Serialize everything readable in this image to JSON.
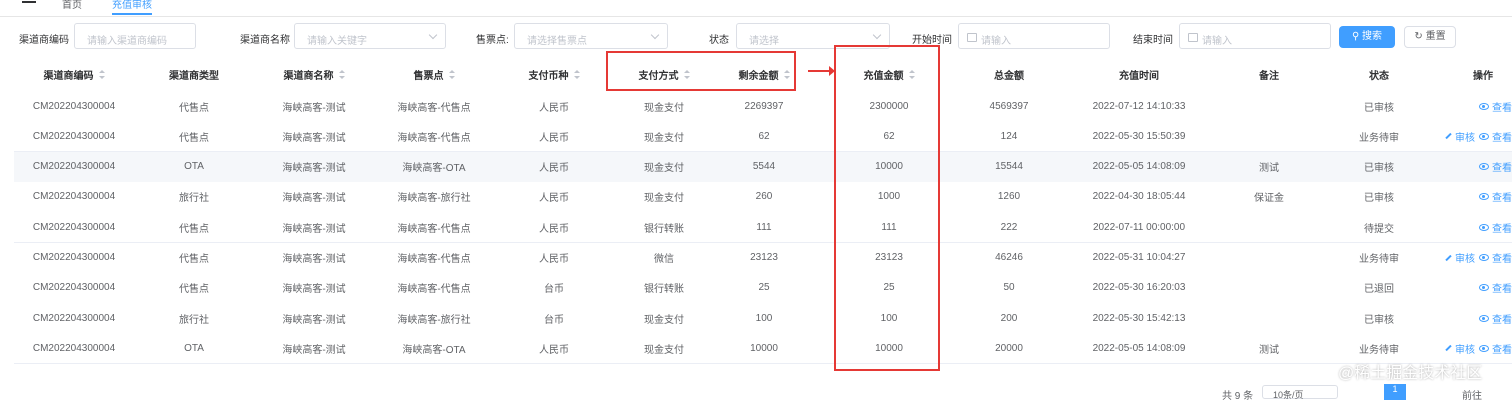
{
  "nav": {
    "breadcrumb_home": "首页",
    "breadcrumb_current": "充值审核"
  },
  "filters": {
    "code_label": "渠道商编码",
    "code_placeholder": "请输入渠道商编码",
    "name_label": "渠道商名称",
    "name_placeholder": "请输入关键字",
    "point_label": "售票点:",
    "point_placeholder": "请选择售票点",
    "status_label": "状态",
    "status_placeholder": "请选择",
    "start_label": "开始时间",
    "start_placeholder": "请输入",
    "end_label": "结束时间",
    "end_placeholder": "请输入",
    "search_label": "搜索",
    "reset_label": "重置"
  },
  "table": {
    "headers": [
      "渠道商编码",
      "渠道商类型",
      "渠道商名称",
      "售票点",
      "支付币种",
      "支付方式",
      "剩余金额",
      "充值金额",
      "总金额",
      "充值时间",
      "备注",
      "状态",
      "操作"
    ],
    "rows": [
      [
        "CM202204300004",
        "代售点",
        "海峡高客-测试",
        "海峡高客-代售点",
        "人民币",
        "现金支付",
        "2269397",
        "2300000",
        "4569397",
        "2022-07-12 14:10:33",
        "",
        "已审核"
      ],
      [
        "CM202204300004",
        "代售点",
        "海峡高客-测试",
        "海峡高客-代售点",
        "人民币",
        "现金支付",
        "62",
        "62",
        "124",
        "2022-05-30 15:50:39",
        "",
        "业务待审"
      ],
      [
        "CM202204300004",
        "OTA",
        "海峡高客-测试",
        "海峡高客-OTA",
        "人民币",
        "现金支付",
        "5544",
        "10000",
        "15544",
        "2022-05-05 14:08:09",
        "测试",
        "已审核"
      ],
      [
        "CM202204300004",
        "旅行社",
        "海峡高客-测试",
        "海峡高客-旅行社",
        "人民币",
        "现金支付",
        "260",
        "1000",
        "1260",
        "2022-04-30 18:05:44",
        "保证金",
        "已审核"
      ],
      [
        "CM202204300004",
        "代售点",
        "海峡高客-测试",
        "海峡高客-代售点",
        "人民币",
        "银行转账",
        "111",
        "111",
        "222",
        "2022-07-11 00:00:00",
        "",
        "待提交"
      ],
      [
        "CM202204300004",
        "代售点",
        "海峡高客-测试",
        "海峡高客-代售点",
        "人民币",
        "微信",
        "23123",
        "23123",
        "46246",
        "2022-05-31 10:04:27",
        "",
        "业务待审"
      ],
      [
        "CM202204300004",
        "代售点",
        "海峡高客-测试",
        "海峡高客-代售点",
        "台币",
        "银行转账",
        "25",
        "25",
        "50",
        "2022-05-30 16:20:03",
        "",
        "已退回"
      ],
      [
        "CM202204300004",
        "旅行社",
        "海峡高客-测试",
        "海峡高客-旅行社",
        "台币",
        "现金支付",
        "100",
        "100",
        "200",
        "2022-05-30 15:42:13",
        "",
        "已审核"
      ],
      [
        "CM202204300004",
        "OTA",
        "海峡高客-测试",
        "海峡高客-OTA",
        "人民币",
        "现金支付",
        "10000",
        "10000",
        "20000",
        "2022-05-05 14:08:09",
        "测试",
        "业务待审"
      ]
    ],
    "audit_rows": [
      1,
      5,
      8
    ],
    "audit_label": "审核",
    "view_label": "查看"
  },
  "pager": {
    "total": "共 9 条",
    "page_size": "10条/页",
    "current": "1",
    "goto": "前往"
  },
  "watermark": "@稀土掘金技术社区",
  "colors": {
    "primary": "#409eff",
    "annotation": "#e53935"
  }
}
